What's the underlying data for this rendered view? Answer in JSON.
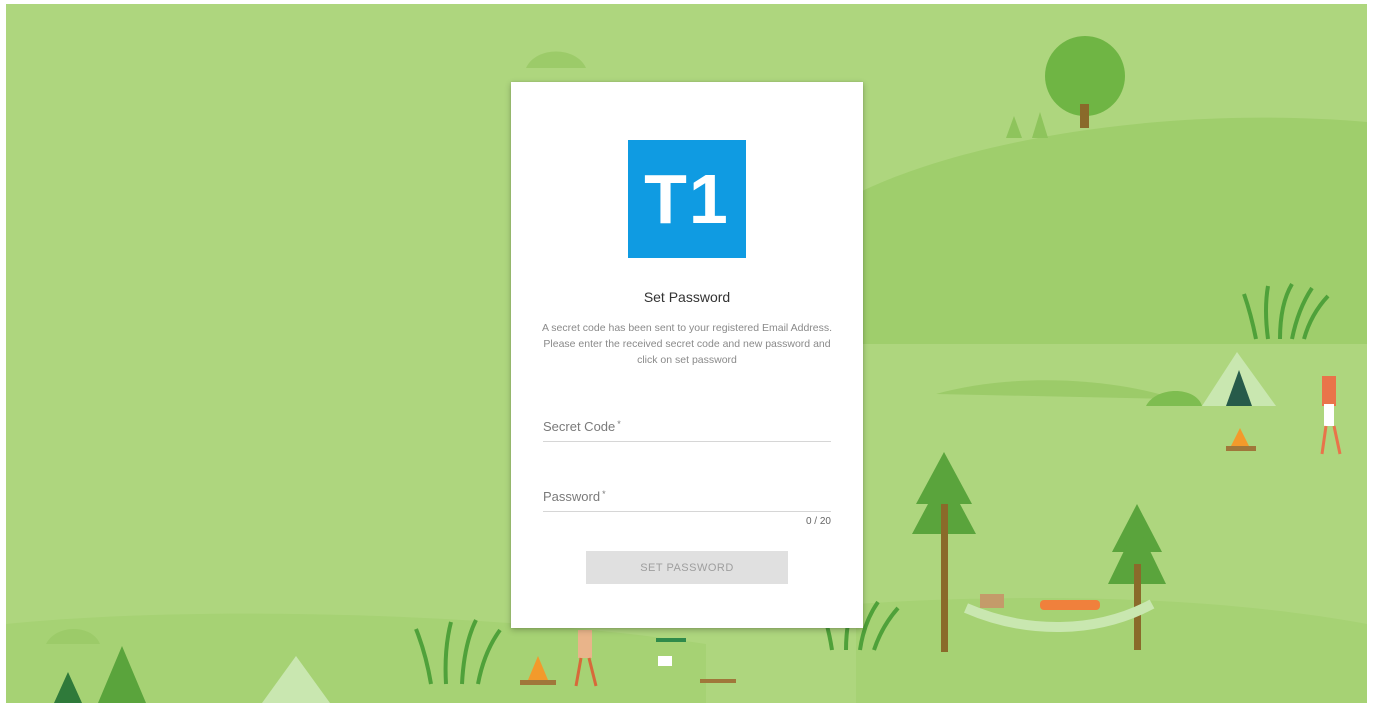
{
  "brand": {
    "logo_text": "T1",
    "logo_color": "#0f9be2"
  },
  "form": {
    "title": "Set Password",
    "description": "A secret code has been sent to your registered Email Address. Please enter the received secret code and new password and click on set password",
    "secret_code": {
      "label": "Secret Code",
      "required_mark": "*",
      "value": ""
    },
    "password": {
      "label": "Password",
      "required_mark": "*",
      "value": "",
      "counter": "0 / 20"
    },
    "submit_label": "SET PASSWORD"
  },
  "theme": {
    "background": "#aed67e",
    "hill_light": "#c3e495",
    "hill_dark": "#8ec45c",
    "tree_green": "#5aa43c",
    "trunk": "#8a6a2a"
  }
}
